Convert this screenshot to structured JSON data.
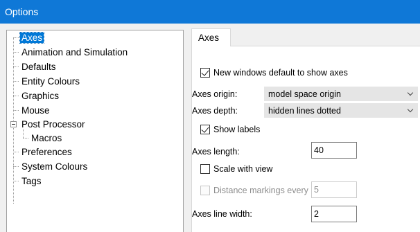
{
  "window": {
    "title": "Options"
  },
  "tree": {
    "items": [
      {
        "label": "Axes"
      },
      {
        "label": "Animation and Simulation"
      },
      {
        "label": "Defaults"
      },
      {
        "label": "Entity Colours"
      },
      {
        "label": "Graphics"
      },
      {
        "label": "Mouse"
      },
      {
        "label": "Post Processor"
      },
      {
        "label": "Macros"
      },
      {
        "label": "Preferences"
      },
      {
        "label": "System Colours"
      },
      {
        "label": "Tags"
      }
    ],
    "selected": "Axes"
  },
  "tab": {
    "label": "Axes"
  },
  "settings": {
    "new_windows_axes": {
      "label": "New windows default to show axes",
      "checked": true
    },
    "axes_origin": {
      "label": "Axes origin:",
      "value": "model space origin"
    },
    "axes_depth": {
      "label": "Axes depth:",
      "value": "hidden lines dotted"
    },
    "show_labels": {
      "label": "Show labels",
      "checked": true
    },
    "axes_length": {
      "label": "Axes length:",
      "value": "40"
    },
    "scale_with_view": {
      "label": "Scale with view",
      "checked": false
    },
    "distance_markings": {
      "label": "Distance markings every",
      "value": "5",
      "enabled": false,
      "checked": false
    },
    "axes_line_width": {
      "label": "Axes line width:",
      "value": "2"
    }
  },
  "colors": {
    "titlebar": "#0f78d7",
    "selection": "#0078d7"
  }
}
